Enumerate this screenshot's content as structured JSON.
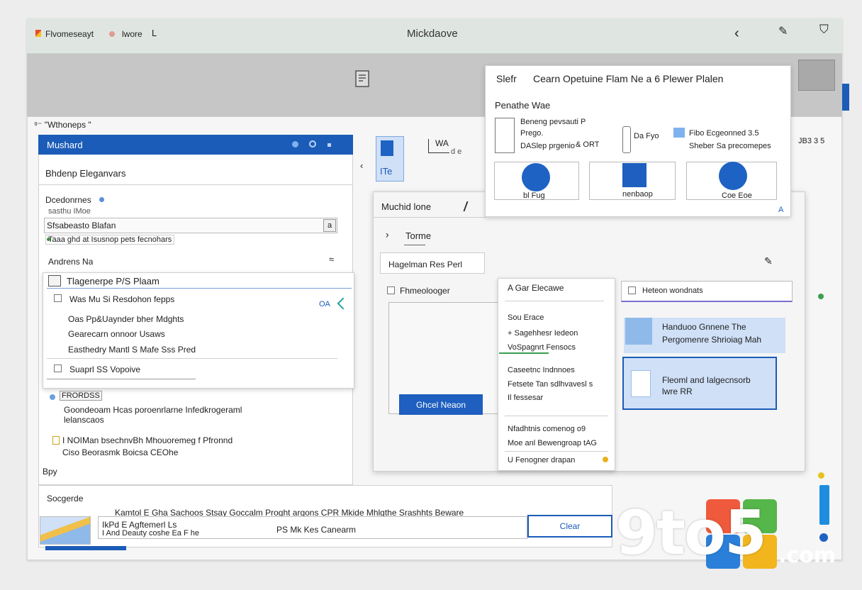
{
  "app": {
    "title": "Mickdaove",
    "breadcrumb": "Flvomeseayt",
    "breadcrumb_2": "lwore",
    "breadcrumb_sep": "L",
    "back_glyph": "‹",
    "pen_glyph": "✎",
    "account_glyph": "⛉"
  },
  "toolbar": {
    "path_label": "⁹⁻ \"Wthoneps \""
  },
  "left_panel": {
    "header": "Mushard",
    "heading": "Bhdenp Eleganvars",
    "section_label": "Dcedonrnes",
    "section_sub": "sasthu IMoe",
    "field_label": "Sfsabeasto Blafan",
    "field_button": "a",
    "hint": "Taaa ghd at Isusnop pets fecnohars",
    "row_label": "Andrens Na",
    "row_glyph": "≈"
  },
  "list_card": {
    "title": "Tlagenerpe P/S Plaam",
    "items": [
      "Was Mu Si Resdohon fepps",
      "Oas Pp&Uaynder bher Mdghts",
      "Gearecarn onnoor Usaws",
      "Easthedry Mantl S Mafe Sss Pred",
      "Suaprl SS Vopoive"
    ],
    "side_tag": "OA"
  },
  "left_lower": {
    "tag": "FRORDSS",
    "desc_1": "Goondeoam Hcas poroenrlarne Infedkrogeraml",
    "desc_2": "lelanscaos",
    "desc_3": "I NOIMan bsechnvBh Mhouoremeg f Pfronnd",
    "desc_4": "Ciso Beorasmk Boicsa CEOhe",
    "small_label": "Bpy"
  },
  "bottom": {
    "section_label": "Socgerde",
    "long_text": "Kamtol E Gha Sachoos Stsay Goccalm Proght argons CPR Mkide Mhlgthe Srashhts Beware",
    "input_text_1": "IkPd E Agftemerl Ls",
    "input_text_2": "I And Deauty coshe Ea F he",
    "input_text_3": "PS Mk Kes Canearm",
    "clear_button": "Clear"
  },
  "mid_tools": {
    "tool_label": "ITe",
    "tool_label_2": "WA",
    "tool_caption": "d e"
  },
  "dialog": {
    "title": "Muchid lone",
    "section": "Torme",
    "selected_item": "Hagelman Res Perl",
    "checkbox_label": "Fhmeolooger",
    "primary_button": "Ghcel Neaon",
    "popup": {
      "title": "A Gar Elecawe",
      "items": [
        "Sou Erace",
        "+ Sagehhesr Iedeon",
        "VoSpagnrt Fensocs",
        "Caseetnc Indnnoes",
        "Fetsete Tan sdlhvavesl s",
        "Il fessesar",
        "Nfadhtnis comenog o9",
        "Moe anl Bewengroap tAG",
        "U Fenogner drapan"
      ]
    },
    "search_placeholder": "Heteon wondnats",
    "card_1_title": "Handuoo Gnnene The",
    "card_1_sub": "Pergomenre Shrioiag Mah",
    "card_2_title": "Fleoml and Ialgecnsorb",
    "card_2_sub": "lwre RR"
  },
  "top_panel": {
    "title": "Slefr",
    "title_2": "Cearn Opetuine Flam Ne a 6 Plewer Plalen",
    "subtitle": "Penathe Wae",
    "row_1a": "Beneng pevsauti P",
    "row_1b": "Prego.",
    "row_1c": "DASlep prgenio",
    "row_1d": "& ORT",
    "ruler_label": "Da Fyo",
    "row_2a": "Fibo Ecgeonned 3.5",
    "row_2b": "Sheber Sa precomepes",
    "tiles": [
      "bl Fug",
      "nenbaop",
      "Coe Eoe"
    ],
    "corner": "A"
  },
  "right_side": {
    "num_label": "JB3 3 5"
  },
  "watermark": {
    "text": "9to5",
    "suffix": ".com"
  },
  "colors": {
    "accent": "#1b5cb8",
    "accent_light": "#cfe0f7",
    "title_bg": "#dfe6e2"
  }
}
